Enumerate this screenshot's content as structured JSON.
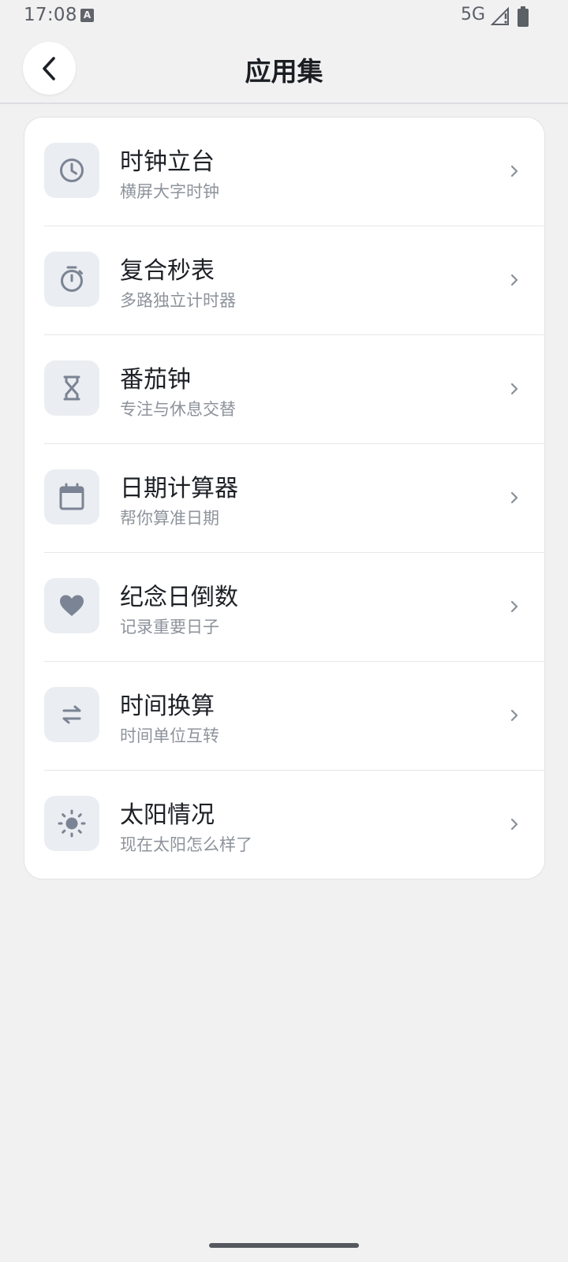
{
  "status_bar": {
    "time": "17:08",
    "notification_icon": "a-notification-icon",
    "network": "5G",
    "signal_icon": "signal-icon",
    "battery_icon": "battery-icon"
  },
  "header": {
    "title": "应用集",
    "back_icon": "chevron-left-icon"
  },
  "apps": [
    {
      "title": "时钟立台",
      "subtitle": "横屏大字时钟",
      "icon": "clock-icon"
    },
    {
      "title": "复合秒表",
      "subtitle": "多路独立计时器",
      "icon": "stopwatch-icon"
    },
    {
      "title": "番茄钟",
      "subtitle": "专注与休息交替",
      "icon": "hourglass-icon"
    },
    {
      "title": "日期计算器",
      "subtitle": "帮你算准日期",
      "icon": "calendar-icon"
    },
    {
      "title": "纪念日倒数",
      "subtitle": "记录重要日子",
      "icon": "heart-icon"
    },
    {
      "title": "时间换算",
      "subtitle": "时间单位互转",
      "icon": "swap-arrows-icon"
    },
    {
      "title": "太阳情况",
      "subtitle": "现在太阳怎么样了",
      "icon": "sun-icon"
    }
  ],
  "colors": {
    "background": "#f1f1f2",
    "card": "#ffffff",
    "icon_tile": "#eaedf1",
    "icon_fg": "#7b8494",
    "title": "#1d2025",
    "subtitle": "#8e939b",
    "chevron": "#8a8f97"
  }
}
